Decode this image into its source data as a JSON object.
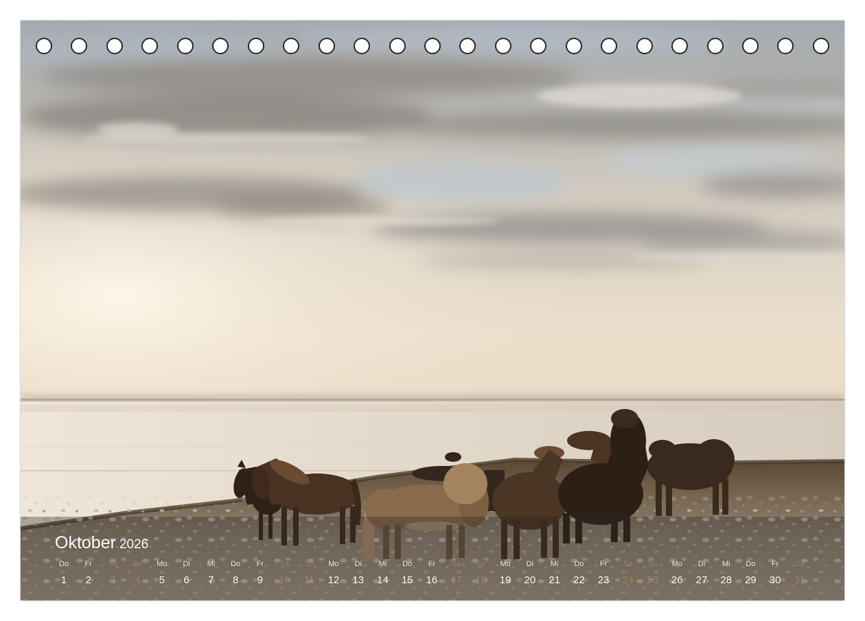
{
  "calendar": {
    "month": "Oktober",
    "year": "2026",
    "days": [
      {
        "weekday": "Do",
        "day": "1"
      },
      {
        "weekday": "Fr",
        "day": "2"
      },
      {
        "weekday": "Sa",
        "day": "3",
        "weekend": true
      },
      {
        "weekday": "So",
        "day": "4",
        "weekend": true
      },
      {
        "weekday": "Mo",
        "day": "5"
      },
      {
        "weekday": "Di",
        "day": "6"
      },
      {
        "weekday": "Mi",
        "day": "7"
      },
      {
        "weekday": "Do",
        "day": "8"
      },
      {
        "weekday": "Fr",
        "day": "9"
      },
      {
        "weekday": "Sa",
        "day": "10",
        "weekend": true
      },
      {
        "weekday": "So",
        "day": "11",
        "weekend": true
      },
      {
        "weekday": "Mo",
        "day": "12"
      },
      {
        "weekday": "Di",
        "day": "13"
      },
      {
        "weekday": "Mi",
        "day": "14"
      },
      {
        "weekday": "Do",
        "day": "15"
      },
      {
        "weekday": "Fr",
        "day": "16"
      },
      {
        "weekday": "Sa",
        "day": "17",
        "weekend": true
      },
      {
        "weekday": "So",
        "day": "18",
        "weekend": true
      },
      {
        "weekday": "Mo",
        "day": "19"
      },
      {
        "weekday": "Di",
        "day": "20"
      },
      {
        "weekday": "Mi",
        "day": "21"
      },
      {
        "weekday": "Do",
        "day": "22"
      },
      {
        "weekday": "Fr",
        "day": "23"
      },
      {
        "weekday": "Sa",
        "day": "24",
        "weekend": true
      },
      {
        "weekday": "So",
        "day": "25",
        "weekend": true
      },
      {
        "weekday": "Mo",
        "day": "26"
      },
      {
        "weekday": "Di",
        "day": "27"
      },
      {
        "weekday": "Mi",
        "day": "28"
      },
      {
        "weekday": "Do",
        "day": "29"
      },
      {
        "weekday": "Fr",
        "day": "30"
      },
      {
        "weekday": "Sa",
        "day": "31",
        "weekend": true
      }
    ]
  },
  "colors": {
    "text": "#ffffff",
    "weekend": "#d39a5e",
    "binding_hole_outline": "#262626"
  }
}
